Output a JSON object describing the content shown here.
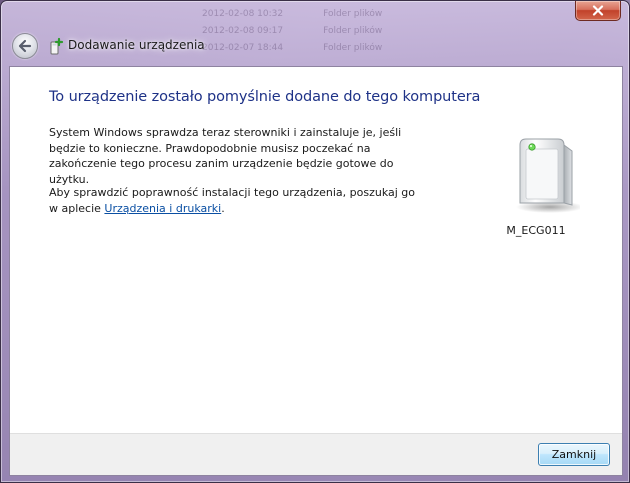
{
  "window": {
    "title": "Dodawanie urządzenia"
  },
  "background_rows": [
    [
      "2012-02-08 10:32",
      "Folder plików"
    ],
    [
      "2012-02-08 09:17",
      "Folder plików"
    ],
    [
      "2012-02-07 18:44",
      "Folder plików"
    ]
  ],
  "content": {
    "heading": "To urządzenie zostało pomyślnie dodane do tego komputera",
    "paragraph1": "System Windows sprawdza teraz sterowniki i zainstaluje je, jeśli będzie to konieczne. Prawdopodobnie musisz poczekać na zakończenie tego procesu zanim urządzenie będzie gotowe do użytku.",
    "paragraph2_prefix": "Aby sprawdzić poprawność instalacji tego urządzenia, poszukaj go w aplecie ",
    "paragraph2_link": "Urządzenia i drukarki",
    "paragraph2_suffix": "."
  },
  "device": {
    "name": "M_ECG011",
    "icon": "generic-device-icon"
  },
  "footer": {
    "close_label": "Zamknij"
  },
  "icons": {
    "back": "back-arrow-icon",
    "title": "add-device-icon",
    "window_close": "close-icon"
  },
  "colors": {
    "heading": "#1e3287",
    "link": "#0a4fa3",
    "close_caption": "#c1412a",
    "button_border": "#3c7fb1"
  }
}
